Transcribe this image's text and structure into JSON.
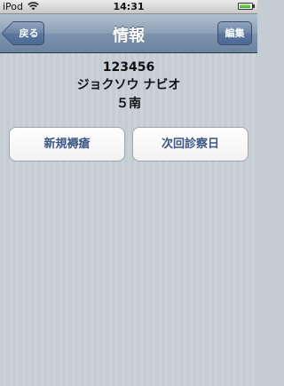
{
  "status_bar": {
    "carrier": "iPod",
    "time": "14:31",
    "battery_level": 0.95
  },
  "nav_bar": {
    "title": "情報",
    "back_label": "戻る",
    "edit_label": "編集"
  },
  "patient": {
    "id": "123456",
    "name": "ジョクソウ ナビオ",
    "ward": "５南"
  },
  "actions": [
    {
      "label": "新規褥瘡"
    },
    {
      "label": "次回診察日"
    }
  ],
  "colors": {
    "background": "#c5ccd4",
    "nav_bar": "#6d84a2",
    "button_text": "#3c5685",
    "battery": "#3fb021"
  },
  "icons": [
    "wifi-icon",
    "battery-icon"
  ]
}
